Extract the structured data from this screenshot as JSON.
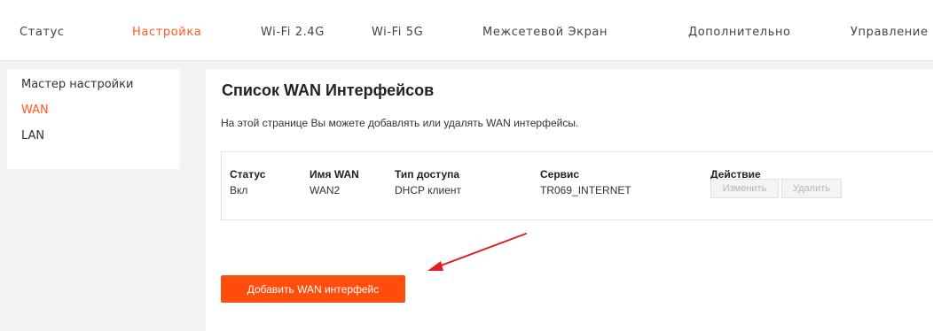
{
  "nav": {
    "items": [
      {
        "label": "Статус",
        "active": false
      },
      {
        "label": "Настройка",
        "active": true
      },
      {
        "label": "Wi-Fi 2.4G",
        "active": false
      },
      {
        "label": "Wi-Fi 5G",
        "active": false
      },
      {
        "label": "Межсетевой Экран",
        "active": false
      },
      {
        "label": "Дополнительно",
        "active": false
      },
      {
        "label": "Управление",
        "active": false
      }
    ]
  },
  "sidebar": {
    "items": [
      {
        "label": "Мастер настройки",
        "active": false
      },
      {
        "label": "WAN",
        "active": true
      },
      {
        "label": "LAN",
        "active": false
      }
    ]
  },
  "main": {
    "title": "Список WAN Интерфейсов",
    "description": "На этой странице Вы можете добавлять или удалять WAN интерфейсы.",
    "table": {
      "headers": [
        "Статус",
        "Имя WAN",
        "Тип доступа",
        "Сервис",
        "Действие"
      ],
      "rows": [
        {
          "status": "Вкл",
          "name": "WAN2",
          "access_type": "DHCP клиент",
          "service": "TR069_INTERNET"
        }
      ],
      "edit_label": "Изменить",
      "delete_label": "Удалить"
    },
    "add_button_label": "Добавить WAN интерфейс"
  },
  "colors": {
    "accent": "#ff5a1f",
    "button": "#ff4d0d",
    "annotation_arrow": "#e02020"
  },
  "icons": {
    "annotation": "red-arrow-icon"
  }
}
